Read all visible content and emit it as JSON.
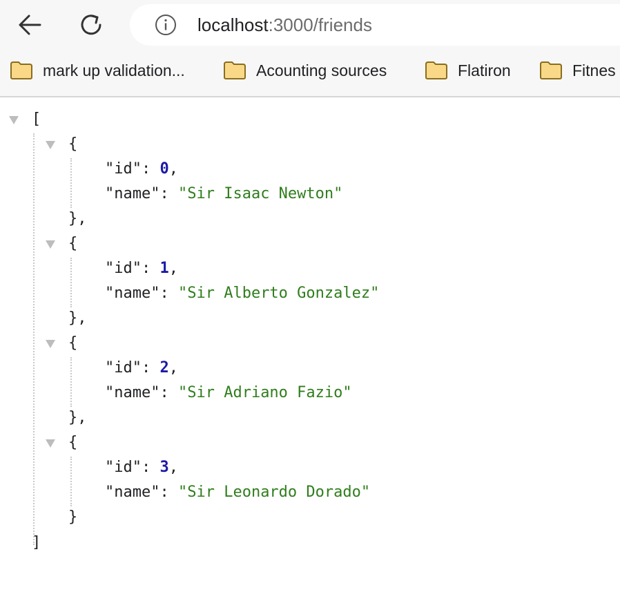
{
  "address_bar": {
    "host": "localhost",
    "rest": ":3000/friends"
  },
  "bookmarks": [
    {
      "label": "mark up validation..."
    },
    {
      "label": "Acounting sources"
    },
    {
      "label": "Flatiron"
    },
    {
      "label": "Fitnes"
    }
  ],
  "json": {
    "open_array": "[",
    "close_array": "]",
    "open_obj": "{",
    "close_obj_comma": "},",
    "close_obj": "}",
    "key_id": "\"id\"",
    "key_name": "\"name\"",
    "colon": ": ",
    "comma": ",",
    "items": [
      {
        "id": "0",
        "name": "\"Sir Isaac Newton\""
      },
      {
        "id": "1",
        "name": "\"Sir Alberto Gonzalez\""
      },
      {
        "id": "2",
        "name": "\"Sir Adriano Fazio\""
      },
      {
        "id": "3",
        "name": "\"Sir Leonardo Dorado\""
      }
    ]
  },
  "colors": {
    "number": "#1a1aa6",
    "string": "#2f7d1c",
    "toolbar_bg": "#f7f7f7"
  },
  "icons": [
    "back-arrow-icon",
    "reload-icon",
    "info-icon",
    "folder-icon"
  ]
}
